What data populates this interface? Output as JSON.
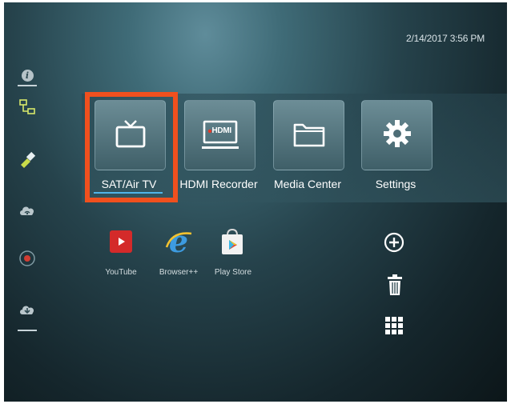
{
  "status": {
    "datetime": "2/14/2017 3:56 PM"
  },
  "sidebar": {
    "items": [
      {
        "icon": "info-icon"
      },
      {
        "icon": "network-icon"
      },
      {
        "icon": "usb-icon"
      },
      {
        "icon": "wifi-cloud-icon"
      },
      {
        "icon": "record-icon"
      },
      {
        "icon": "download-cloud-icon"
      }
    ]
  },
  "main_tiles": [
    {
      "label": "SAT/Air TV",
      "icon": "tv-icon",
      "selected": true
    },
    {
      "label": "HDMI Recorder",
      "icon": "hdmi-recorder-icon",
      "badge": "HDMI"
    },
    {
      "label": "Media Center",
      "icon": "folder-icon"
    },
    {
      "label": "Settings",
      "icon": "gear-icon"
    }
  ],
  "apps": [
    {
      "label": "YouTube",
      "icon": "youtube-icon"
    },
    {
      "label": "Browser++",
      "icon": "browser-icon"
    },
    {
      "label": "Play Store",
      "icon": "play-store-icon"
    }
  ],
  "tools": [
    {
      "icon": "add-icon"
    },
    {
      "icon": "trash-icon"
    },
    {
      "icon": "apps-grid-icon"
    }
  ],
  "colors": {
    "selection": "#f0501e",
    "focus_underline": "#4fb4e8"
  }
}
